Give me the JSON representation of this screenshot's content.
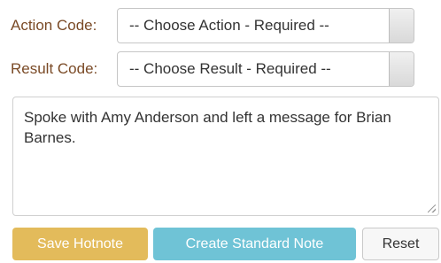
{
  "form": {
    "action": {
      "label": "Action Code:",
      "selected": "-- Choose Action - Required --"
    },
    "result": {
      "label": "Result Code:",
      "selected": "-- Choose Result - Required --"
    },
    "note_text": "Spoke with Amy Anderson and left a message for Brian Barnes."
  },
  "buttons": {
    "save_hotnote": "Save Hotnote",
    "create_standard_note": "Create Standard Note",
    "reset": "Reset"
  },
  "colors": {
    "label_text": "#7a4a26",
    "save_hotnote_bg": "#e3bb5b",
    "create_standard_note_bg": "#6fc3d6"
  }
}
